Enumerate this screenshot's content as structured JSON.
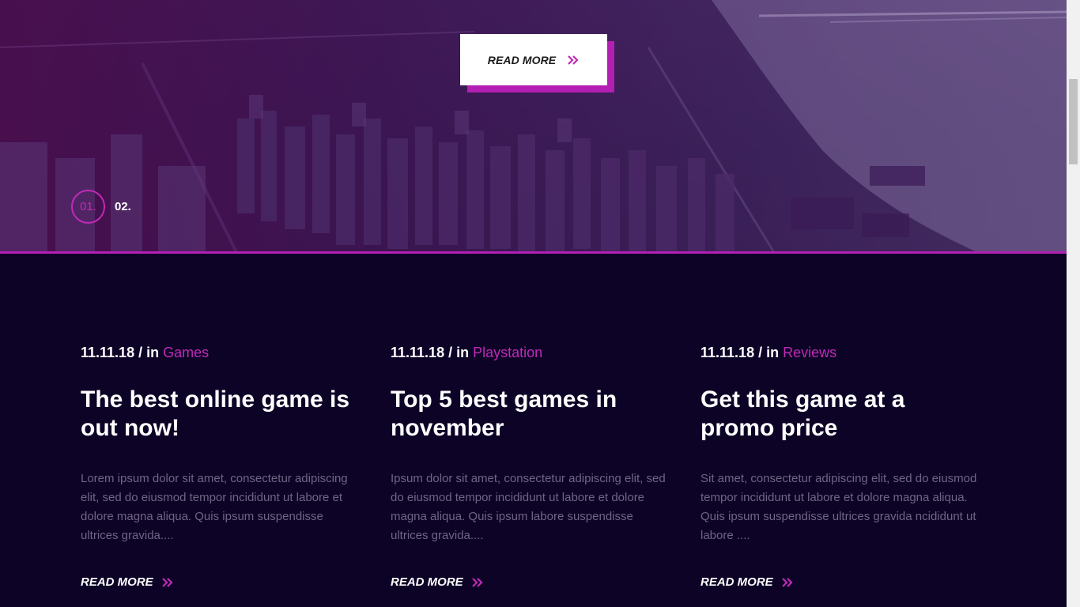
{
  "hero": {
    "cta_label": "READ MORE",
    "pager": {
      "active": "01.",
      "next": "02."
    }
  },
  "posts": [
    {
      "date": "11.11.18",
      "in": "/ in",
      "category": "Games",
      "title": "The best online game is out now!",
      "excerpt": "Lorem ipsum dolor sit amet, consectetur adipiscing elit, sed do eiusmod tempor incididunt ut labore et dolore magna aliqua. Quis ipsum suspendisse ultrices gravida....",
      "more": "READ MORE"
    },
    {
      "date": "11.11.18",
      "in": "/ in",
      "category": "Playstation",
      "title": "Top 5 best games in november",
      "excerpt": "Ipsum dolor sit amet, consectetur adipiscing elit, sed do eiusmod tempor incididunt ut labore et dolore magna aliqua. Quis ipsum labore suspendisse ultrices gravida....",
      "more": "READ MORE"
    },
    {
      "date": "11.11.18",
      "in": "/ in",
      "category": "Reviews",
      "title": "Get this game at a promo price",
      "excerpt": "Sit amet, consectetur adipiscing elit, sed do eiusmod tempor incididunt ut labore et dolore magna aliqua. Quis ipsum suspendisse ultrices gravida ncididunt ut labore ....",
      "more": "READ MORE"
    }
  ],
  "colors": {
    "accent": "#c02ab8",
    "background": "#0d0326",
    "excerpt": "#716585"
  },
  "icons": {
    "cta": "double-chevron-right-icon"
  }
}
